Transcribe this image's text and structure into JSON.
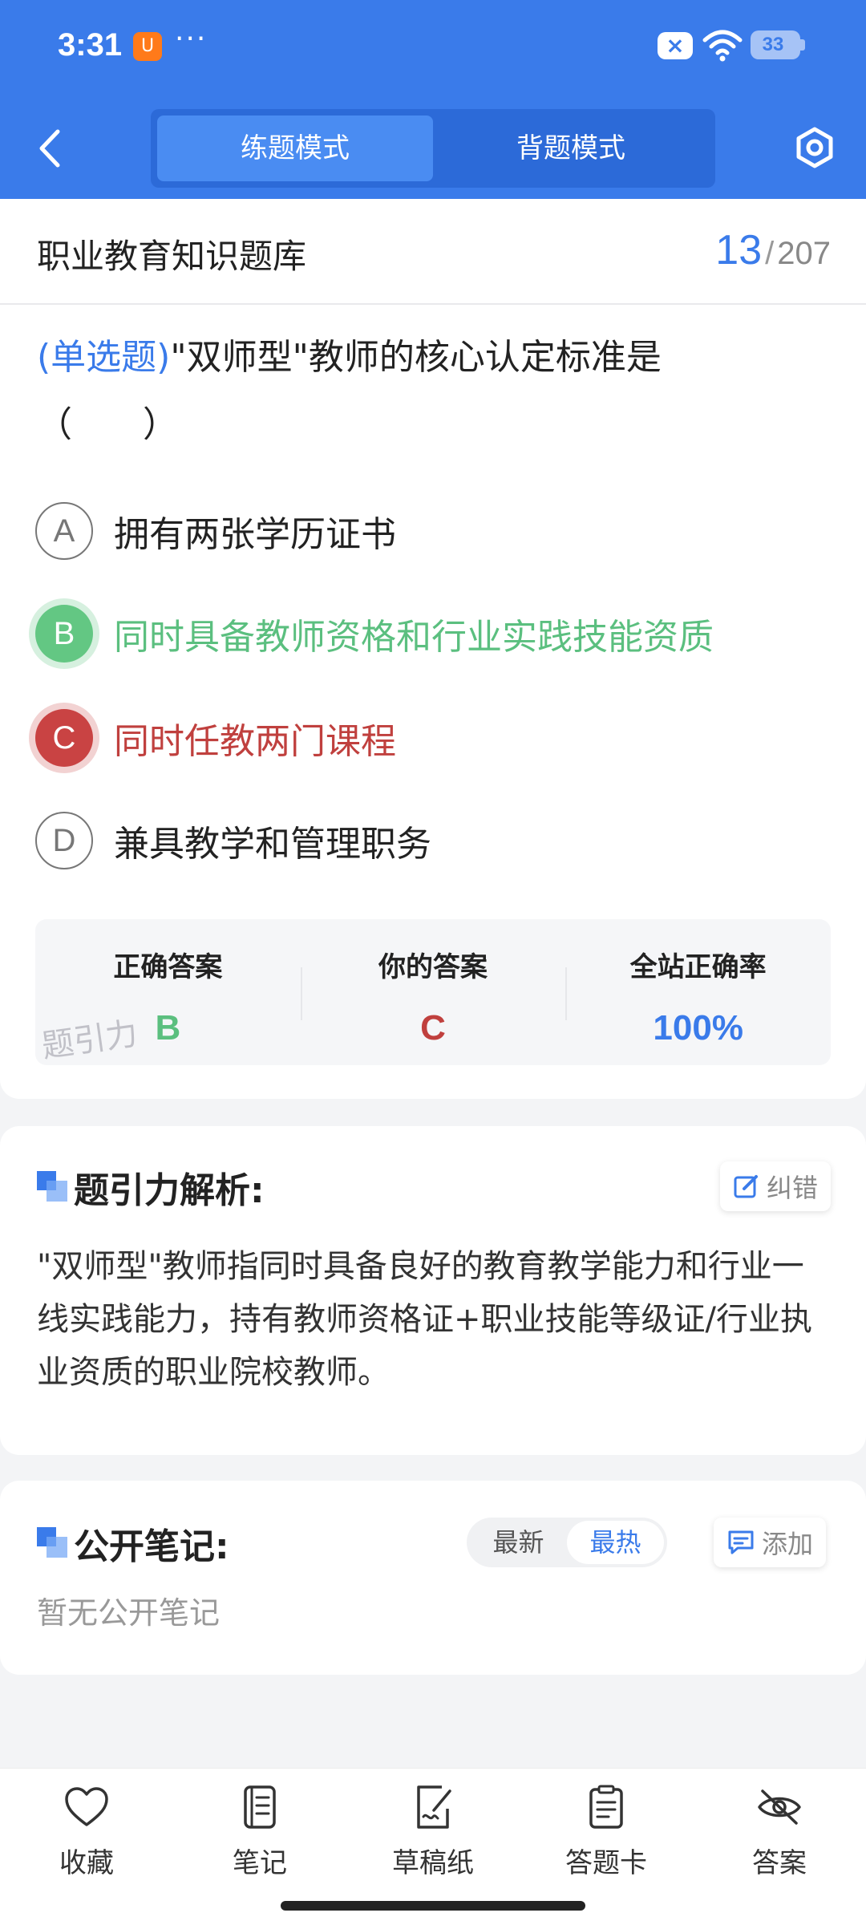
{
  "status_bar": {
    "time": "3:31",
    "app_badge": "U",
    "dots": "···",
    "battery": "33"
  },
  "header": {
    "mode_tabs": [
      {
        "label": "练题模式",
        "active": true
      },
      {
        "label": "背题模式",
        "active": false
      }
    ]
  },
  "question_card": {
    "bank_title": "职业教育知识题库",
    "progress_current": "13",
    "progress_sep": "/",
    "progress_total": "207",
    "question_type": "(单选题)",
    "question_text": "\"双师型\"教师的核心认定标准是",
    "question_blank": "（　　）",
    "options": [
      {
        "letter": "A",
        "text": "拥有两张学历证书",
        "state": "normal"
      },
      {
        "letter": "B",
        "text": "同时具备教师资格和行业实践技能资质",
        "state": "correct"
      },
      {
        "letter": "C",
        "text": "同时任教两门课程",
        "state": "wrong"
      },
      {
        "letter": "D",
        "text": "兼具教学和管理职务",
        "state": "normal"
      }
    ],
    "stats": [
      {
        "label": "正确答案",
        "value": "B"
      },
      {
        "label": "你的答案",
        "value": "C"
      },
      {
        "label": "全站正确率",
        "value": "100%"
      }
    ],
    "watermark": "题引力"
  },
  "analysis": {
    "title": "题引力解析:",
    "report_label": "纠错",
    "text": "\"双师型\"教师指同时具备良好的教育教学能力和行业一线实践能力，持有教师资格证+职业技能等级证/行业执业资质的职业院校教师。"
  },
  "notes": {
    "title": "公开笔记:",
    "sort_options": [
      {
        "label": "最新",
        "active": false
      },
      {
        "label": "最热",
        "active": true
      }
    ],
    "add_label": "添加",
    "empty_text": "暂无公开笔记"
  },
  "bottom_nav": [
    {
      "label": "收藏",
      "icon": "heart-icon"
    },
    {
      "label": "笔记",
      "icon": "notebook-icon"
    },
    {
      "label": "草稿纸",
      "icon": "draft-paper-icon"
    },
    {
      "label": "答题卡",
      "icon": "answer-sheet-icon"
    },
    {
      "label": "答案",
      "icon": "eye-off-icon"
    }
  ],
  "colors": {
    "primary": "#3a7bea",
    "correct": "#5bbf7f",
    "wrong": "#c0403e"
  }
}
